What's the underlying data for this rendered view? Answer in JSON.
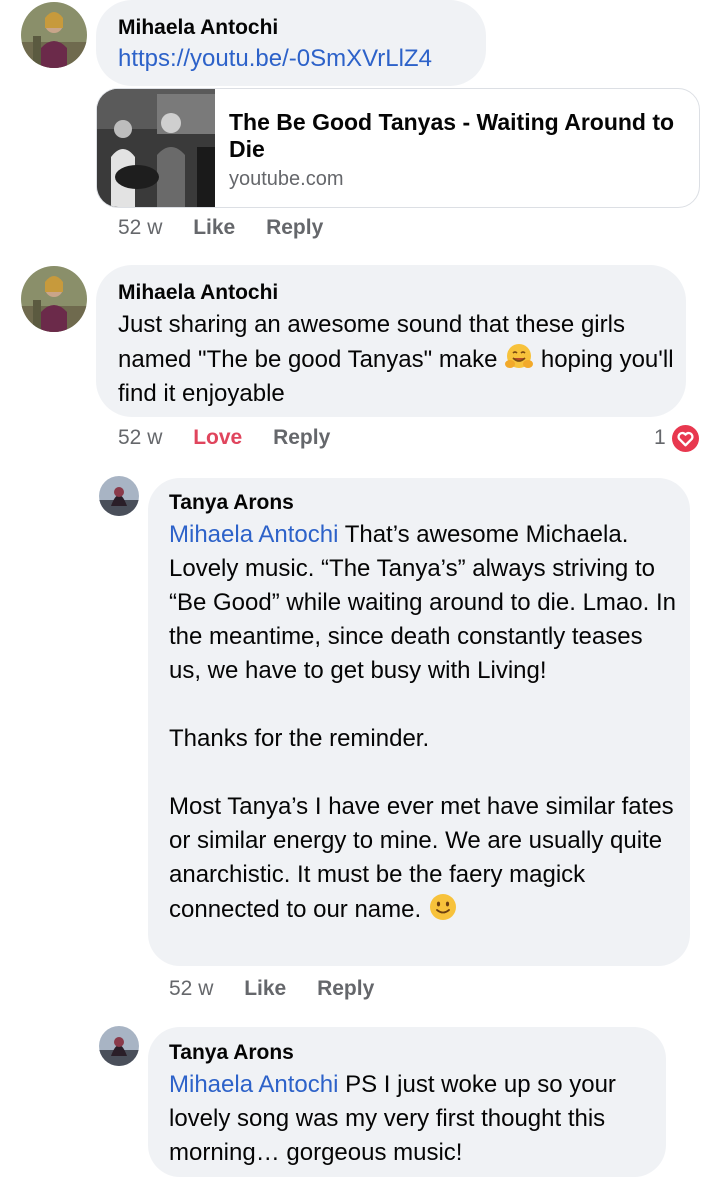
{
  "comments": [
    {
      "author": "Mihaela Antochi",
      "link_text": "https://youtu.be/-0SmXVrLlZ4",
      "card": {
        "title": "The Be Good Tanyas - Waiting Around to Die",
        "domain": "youtube.com"
      },
      "time": "52 w",
      "actions": [
        "Like",
        "Reply"
      ]
    },
    {
      "author": "Mihaela Antochi",
      "text_before_emoji": "Just sharing an awesome sound that these girls named \"The be good Tanyas\" make",
      "text_after_emoji": "hoping you'll find it enjoyable",
      "emoji": "hugging-face-emoji",
      "time": "52 w",
      "actions": [
        "Love",
        "Reply"
      ],
      "reaction_count": "1",
      "reaction_icon": "heart-icon"
    }
  ],
  "replies": [
    {
      "author": "Tanya Arons",
      "mention": "Mihaela Antochi",
      "paragraphs": [
        "That’s awesome Michaela. Lovely music.  “The Tanya’s” always striving to “Be Good” while waiting around to die. Lmao.  In the meantime, since death constantly teases us, we have to get busy with Living!",
        "Thanks for the reminder.",
        "Most Tanya’s I have ever met have similar fates or similar energy to mine.  We are usually quite anarchistic.  It must be the faery magick connected to our name."
      ],
      "emoji": "slightly-smiling-face-emoji",
      "time": "52 w",
      "actions": [
        "Like",
        "Reply"
      ]
    },
    {
      "author": "Tanya Arons",
      "mention": "Mihaela Antochi",
      "text": "PS I just woke up so your lovely song was my very first thought this morning… gorgeous music!"
    }
  ],
  "colors": {
    "bubble": "#f0f2f5",
    "link": "#2d62c9",
    "meta": "#65676b",
    "love": "#e0455d"
  }
}
